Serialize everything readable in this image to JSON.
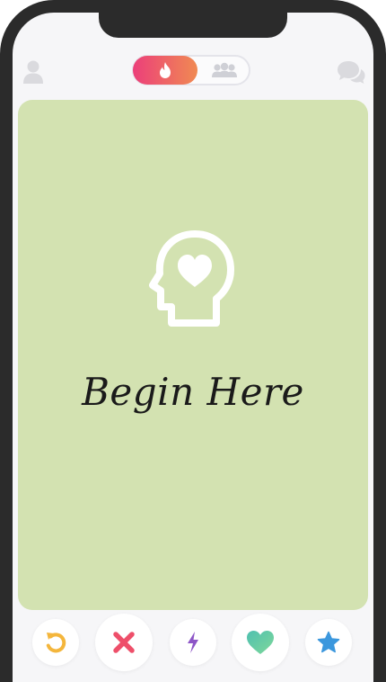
{
  "app": {
    "card_title": "Begin Here"
  },
  "icons": {
    "profile": "user-icon",
    "discover": "flame-icon",
    "groups": "group-icon",
    "messages": "chat-bubbles-icon",
    "card": "head-with-heart-icon",
    "rewind": "rewind-icon",
    "nope": "close-icon",
    "boost": "lightning-icon",
    "like": "heart-icon",
    "super_like": "star-icon"
  },
  "colors": {
    "card_background": "#d3e2b1",
    "toggle_gradient_start": "#ec3f7a",
    "toggle_gradient_end": "#f08a52",
    "rewind": "#f4b63c",
    "nope": "#ee4f6a",
    "boost": "#8d55c7",
    "like": "#5cc4a4",
    "super_like": "#3b97dd"
  }
}
